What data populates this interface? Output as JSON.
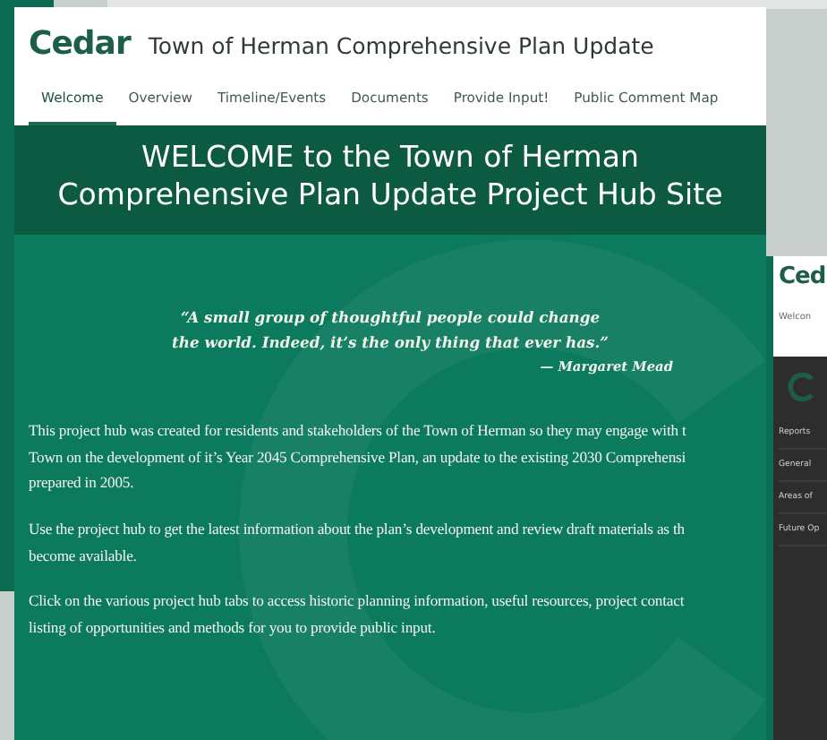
{
  "main_window": {
    "logo": {
      "text": "Cedar"
    },
    "title": "Town of Herman Comprehensive Plan Update",
    "tabs": [
      {
        "label": "Welcome",
        "selected": true
      },
      {
        "label": "Overview",
        "selected": false
      },
      {
        "label": "Timeline/Events",
        "selected": false
      },
      {
        "label": "Documents",
        "selected": false
      },
      {
        "label": "Provide Input!",
        "selected": false
      },
      {
        "label": "Public Comment Map",
        "selected": false
      }
    ],
    "banner": {
      "lines": [
        "WELCOME to the Town of Herman",
        "Comprehensive Plan Update Project Hub Site"
      ]
    },
    "quote": {
      "lines": [
        "“A small group of  thoughtful people could change",
        "the world. Indeed, it’s the only thing that ever has.”"
      ],
      "attribution": "—  Margaret Mead"
    },
    "paragraphs": [
      [
        "This project hub was created for residents and stakeholders of the Town of Herman so they may engage with t",
        "Town on the development of it’s Year 2045 Comprehensive Plan, an update to the existing 2030 Comprehensi",
        "prepared in 2005."
      ],
      [
        "Use the project hub to get the latest information about the plan’s development and review draft materials as th",
        "become available."
      ],
      [
        "Click on the various project hub tabs to access historic planning information, useful resources, project contact",
        "listing of opportunities and methods for you to provide public input."
      ]
    ]
  },
  "side_window": {
    "logo": "Ced",
    "tab": "Welcon",
    "menu": [
      {
        "label": "Reports"
      },
      {
        "label": "General"
      },
      {
        "label": "Areas of"
      },
      {
        "label": "Future Op"
      }
    ]
  }
}
